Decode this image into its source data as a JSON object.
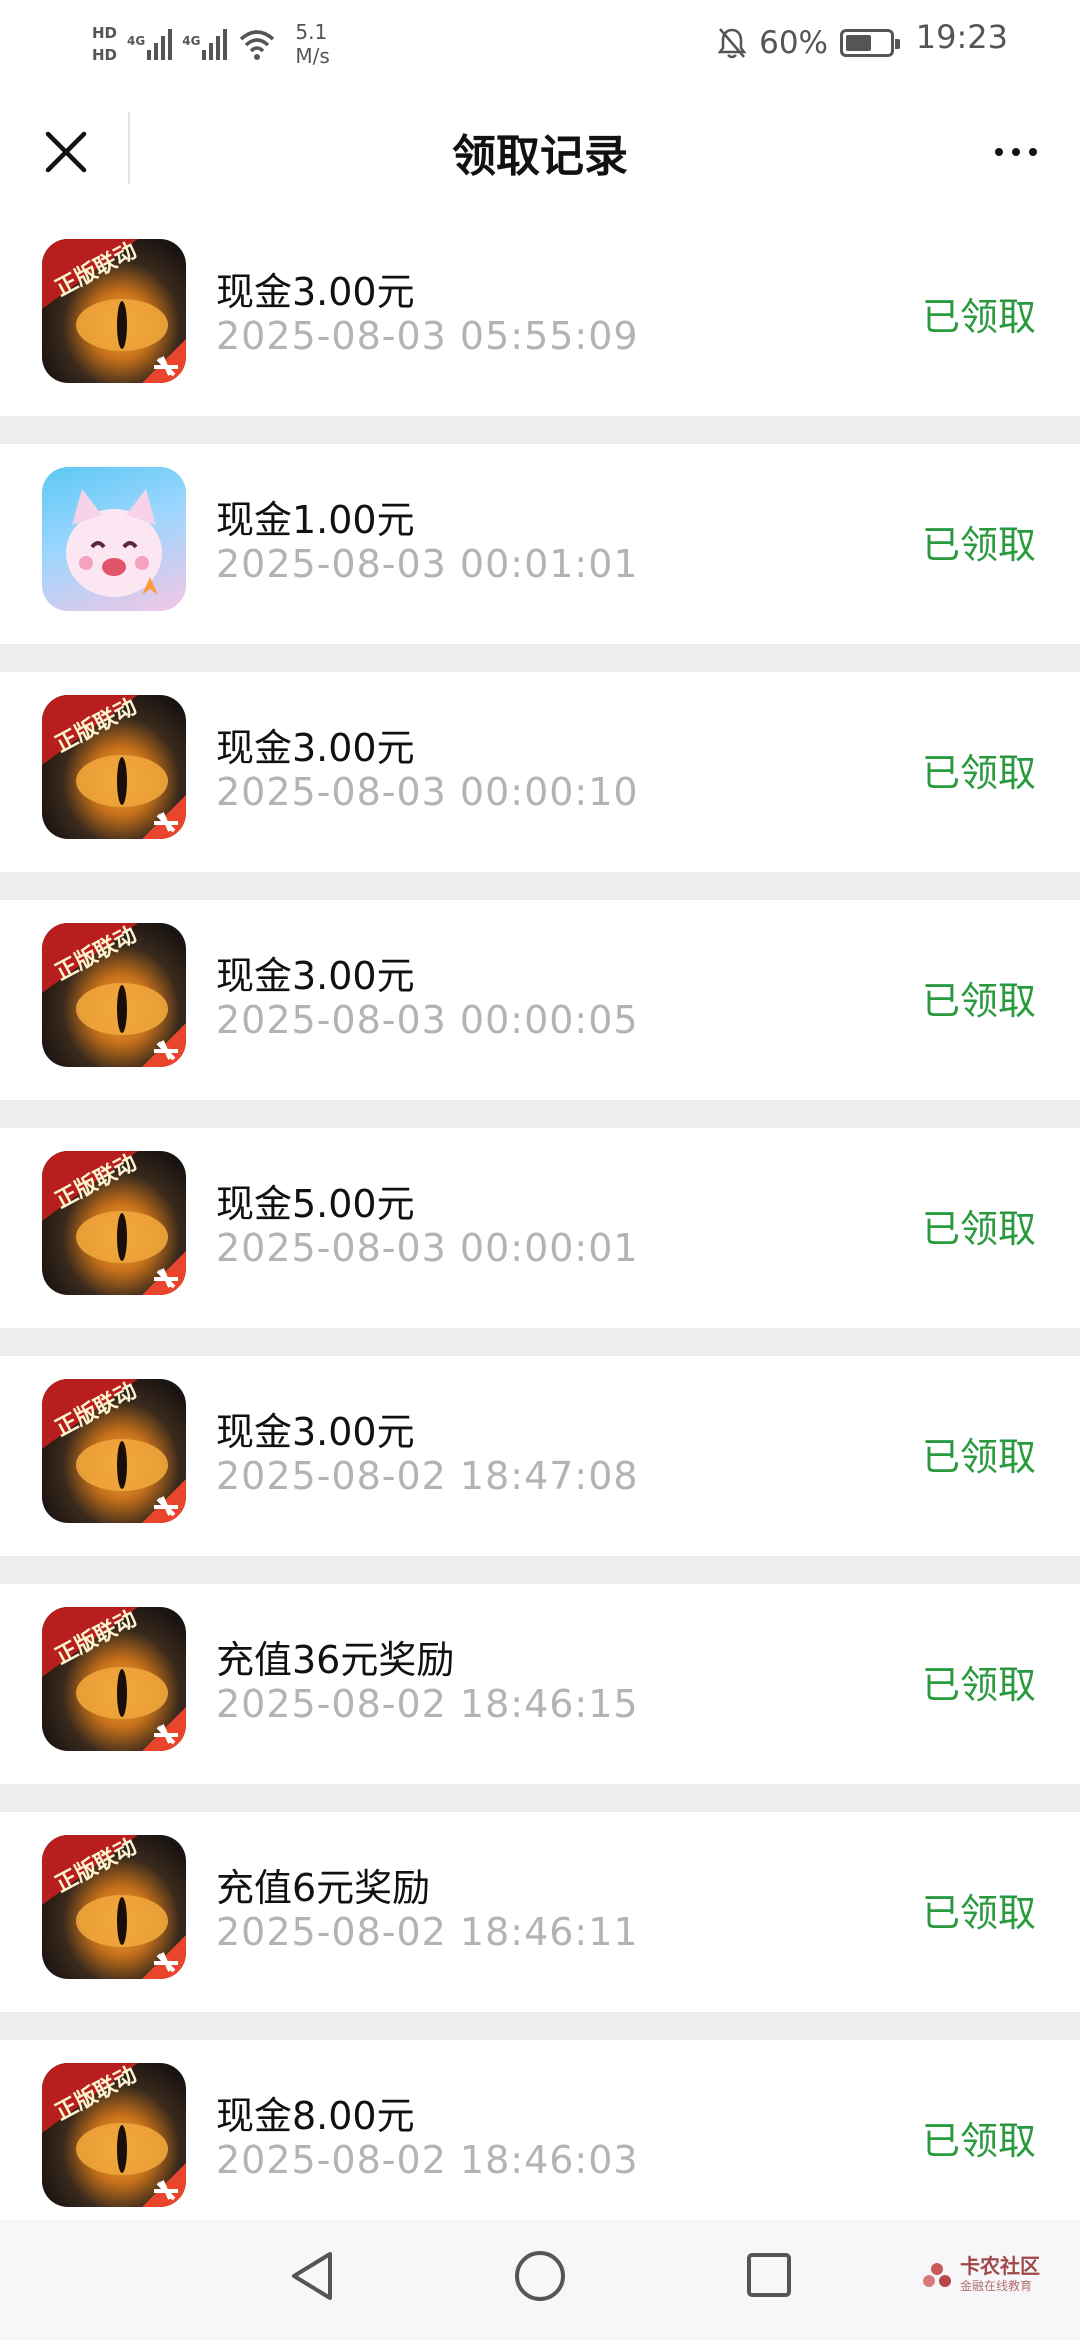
{
  "status_bar": {
    "hd1": "HD",
    "hd2": "HD",
    "net1": "4G",
    "net2": "4G",
    "speed_value": "5.1",
    "speed_unit": "M/s",
    "battery_pct": "60%",
    "battery_level": 0.6,
    "time": "19:23"
  },
  "header": {
    "title": "领取记录"
  },
  "records": [
    {
      "name": "现金3.00元",
      "time": "2025-08-03 05:55:09",
      "status": "已领取",
      "icon": "dragon-game-icon"
    },
    {
      "name": "现金1.00元",
      "time": "2025-08-03 00:01:01",
      "status": "已领取",
      "icon": "cat-game-icon"
    },
    {
      "name": "现金3.00元",
      "time": "2025-08-03 00:00:10",
      "status": "已领取",
      "icon": "dragon-game-icon"
    },
    {
      "name": "现金3.00元",
      "time": "2025-08-03 00:00:05",
      "status": "已领取",
      "icon": "dragon-game-icon"
    },
    {
      "name": "现金5.00元",
      "time": "2025-08-03 00:00:01",
      "status": "已领取",
      "icon": "dragon-game-icon"
    },
    {
      "name": "现金3.00元",
      "time": "2025-08-02 18:47:08",
      "status": "已领取",
      "icon": "dragon-game-icon"
    },
    {
      "name": "充值36元奖励",
      "time": "2025-08-02 18:46:15",
      "status": "已领取",
      "icon": "dragon-game-icon"
    },
    {
      "name": "充值6元奖励",
      "time": "2025-08-02 18:46:11",
      "status": "已领取",
      "icon": "dragon-game-icon"
    },
    {
      "name": "现金8.00元",
      "time": "2025-08-02 18:46:03",
      "status": "已领取",
      "icon": "dragon-game-icon"
    }
  ],
  "icon_badge_text": "正版联动",
  "watermark": {
    "main": "卡农社区",
    "sub": "金融在线教育"
  },
  "colors": {
    "status_green": "#2a9a3e",
    "time_gray": "#b3b3b3",
    "page_bg": "#ededf0"
  }
}
